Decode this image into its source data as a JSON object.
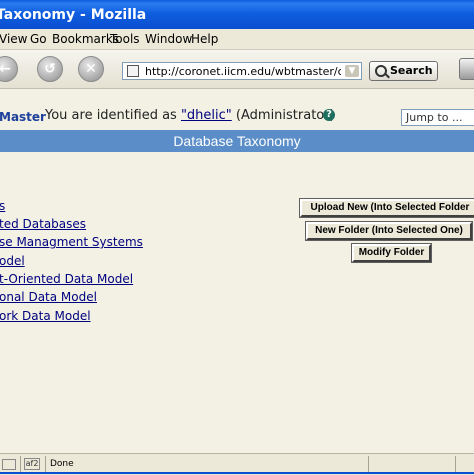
{
  "window": {
    "title": "Taxonomy - Mozilla"
  },
  "menu": [
    "View",
    "Go",
    "Bookmarks",
    "Tools",
    "Window",
    "Help"
  ],
  "toolbar": {
    "url": "http://coronet.iicm.edu/wbtmaster/courses/data",
    "search_label": "Search",
    "url_dropdown_icon": "chevron-down-icon"
  },
  "identity": {
    "site_name": "Master",
    "prefix": "You are identified as ",
    "user": "\"dhelic\"",
    "role": " (Administrator)",
    "help_icon": "?",
    "jump_label": "Jump to ..."
  },
  "page": {
    "header": "Database Taxonomy"
  },
  "tree": [
    "s",
    "ted Databases",
    "se Managment Systems",
    "odel",
    "t-Oriented Data Model",
    "onal Data Model",
    "ork Data Model"
  ],
  "actions": {
    "upload": "Upload New (Into Selected Folder",
    "new_folder": "New Folder (Into Selected One)",
    "modify": "Modify Folder"
  },
  "status": {
    "text": "Done",
    "icon2": "af2"
  },
  "colors": {
    "title_bar": "#0a4fcf",
    "header_band": "#5b8ec8",
    "link": "#00007f"
  }
}
